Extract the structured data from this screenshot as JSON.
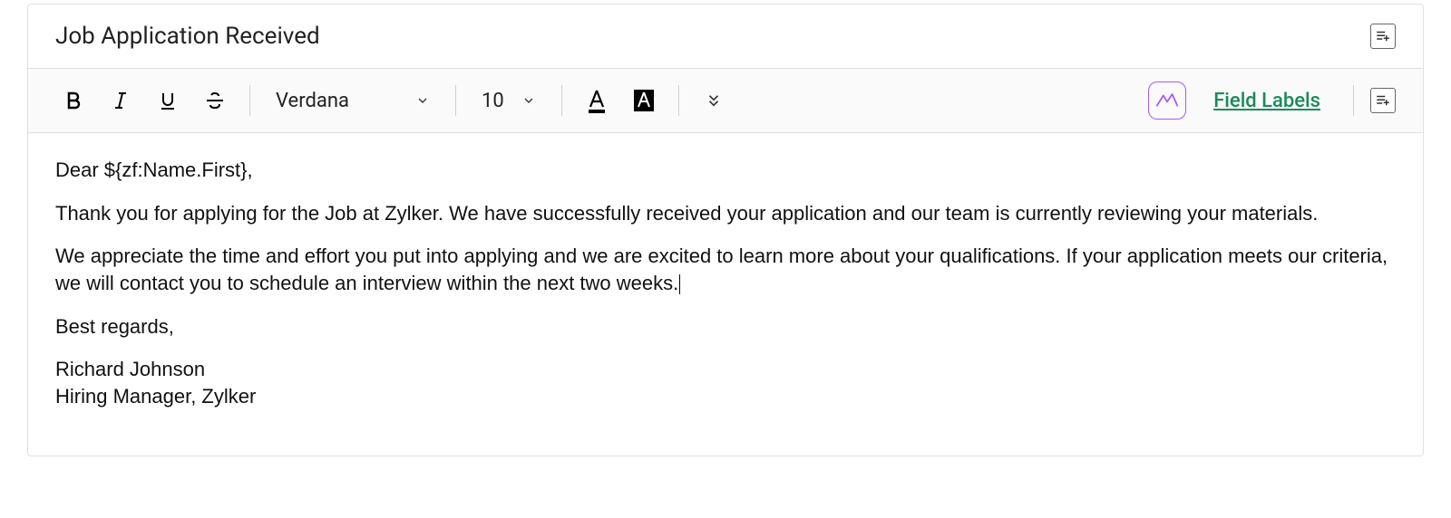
{
  "subject": {
    "value": "Job Application Received"
  },
  "toolbar": {
    "font_family": "Verdana",
    "font_size": "10",
    "field_labels_link": "Field Labels"
  },
  "body": {
    "greeting": "Dear ${zf:Name.First},",
    "para1": "Thank you for applying for the Job at Zylker. We have successfully received your application and our team is currently reviewing your materials.",
    "para2": "We appreciate the time and effort you put into applying and we are excited to learn more about your qualifications. If your application meets our criteria, we will contact you to schedule an interview within the next two weeks.",
    "closing": "Best regards,",
    "signature_name": "Richard Johnson",
    "signature_title": "Hiring Manager, Zylker"
  }
}
